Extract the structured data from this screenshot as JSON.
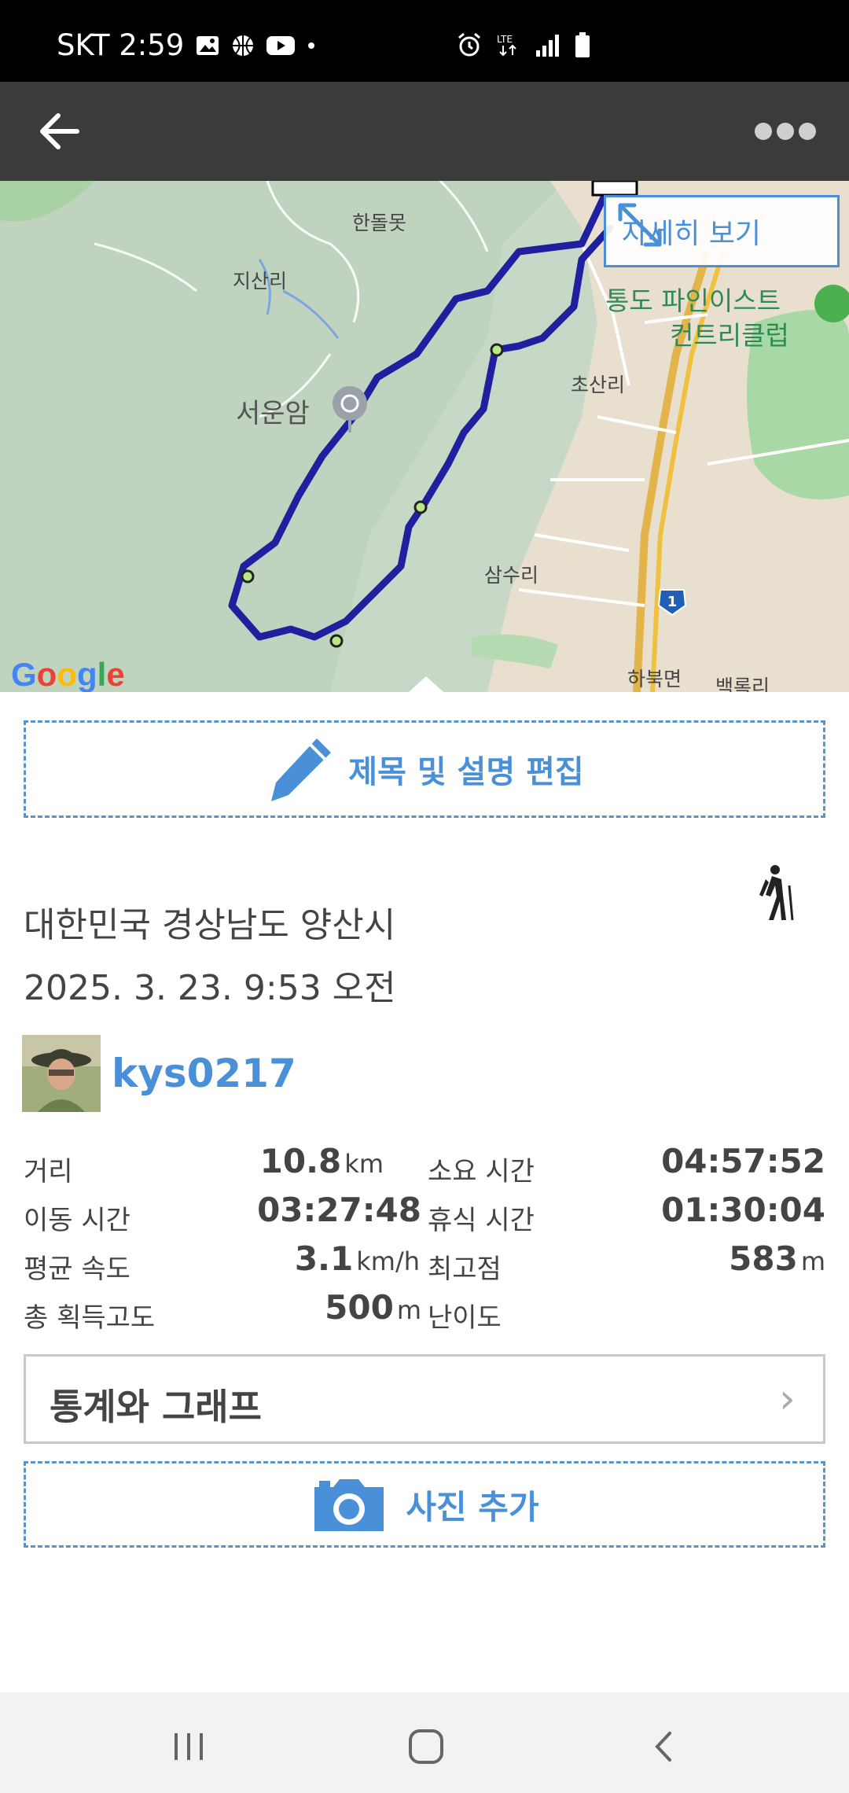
{
  "status_bar": {
    "carrier_time": "SKT 2:59",
    "icons": [
      "gallery-icon",
      "basketball-icon",
      "youtube-icon",
      "dot-icon",
      "alarm-icon",
      "lte-icon",
      "signal-icon",
      "battery-icon"
    ],
    "network": "LTE"
  },
  "app_bar": {
    "back_icon": "arrow-left-icon",
    "more_icon": "more-dots-icon"
  },
  "map": {
    "labels": {
      "handolmot": "한돌못",
      "jisanri": "지산리",
      "tongdo": "통도 파인이스트",
      "country_club": "컨트리클럽",
      "chosanri": "초산리",
      "seounam": "서운암",
      "samsuri": "삼수리",
      "habukmyeon": "하북면",
      "baekrokri": "백록리",
      "route_shield": "1"
    },
    "detail_button": "자세히 보기",
    "attribution": "Google",
    "route_color": "#1f1fa0"
  },
  "edit_button": {
    "label": "제목 및 설명 편집"
  },
  "activity": {
    "location": "대한민국 경상남도 양산시",
    "datetime": "2025. 3. 23. 9:53 오전",
    "activity_icon": "hiker-icon",
    "username": "kys0217"
  },
  "stats": {
    "distance": {
      "label": "거리",
      "value": "10.8",
      "unit": "km"
    },
    "duration": {
      "label": "소요 시간",
      "value": "04:57:52"
    },
    "moving_time": {
      "label": "이동 시간",
      "value": "03:27:48"
    },
    "rest_time": {
      "label": "휴식 시간",
      "value": "01:30:04"
    },
    "avg_speed": {
      "label": "평균 속도",
      "value": "3.1",
      "unit": "km/h"
    },
    "max_elevation": {
      "label": "최고점",
      "value": "583",
      "unit": "m"
    },
    "total_ascent": {
      "label": "총 획득고도",
      "value": "500",
      "unit": "m"
    },
    "difficulty": {
      "label": "난이도",
      "value": ""
    }
  },
  "stats_button": {
    "label": "통계와 그래프",
    "chevron": "›"
  },
  "photo_button": {
    "label": "사진 추가"
  },
  "colors": {
    "accent": "#4a90d9",
    "app_bar": "#3b3b3b",
    "text": "#444444"
  }
}
